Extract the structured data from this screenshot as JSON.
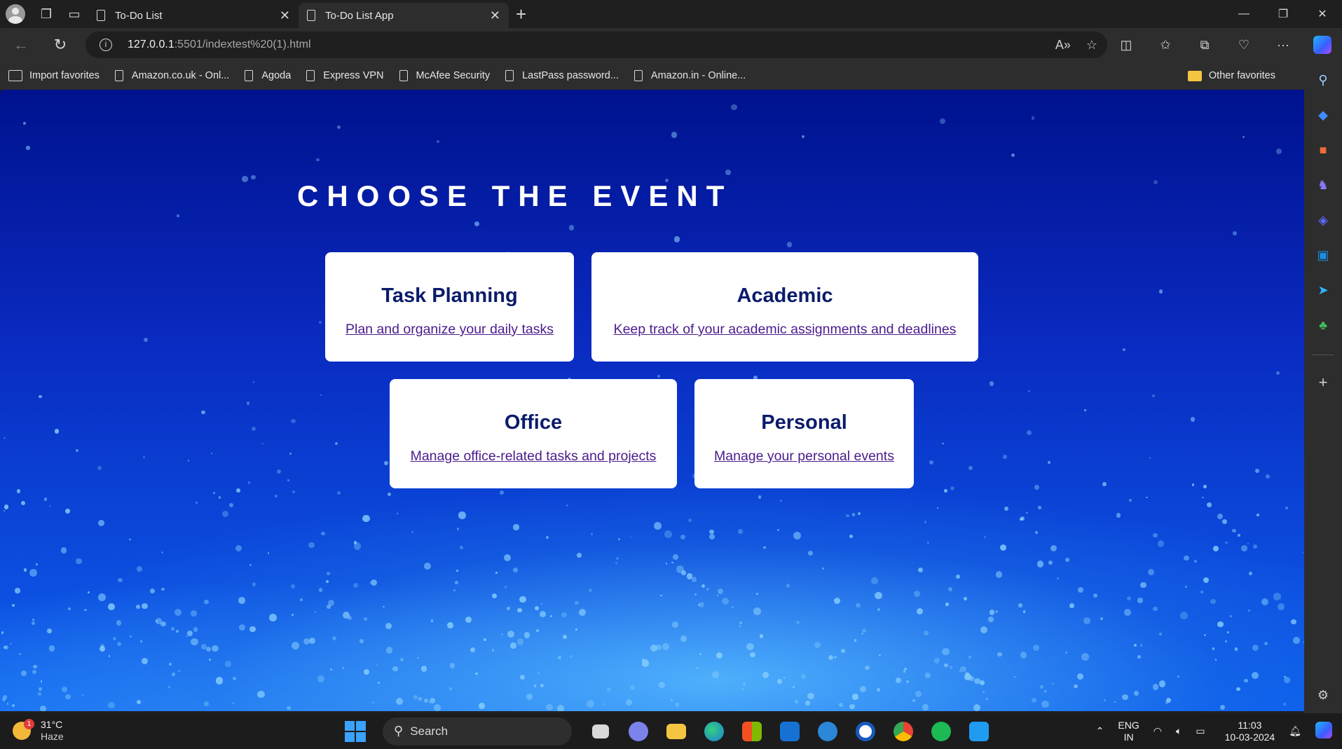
{
  "browser": {
    "tabs": [
      {
        "title": "To-Do List",
        "active": false
      },
      {
        "title": "To-Do List App",
        "active": true
      }
    ],
    "url_host": "127.0.0.1",
    "url_path": ":5501/indextest%20(1).html",
    "favorites": [
      {
        "label": "Import favorites",
        "icon": "import-icon"
      },
      {
        "label": "Amazon.co.uk - Onl...",
        "icon": "page-icon"
      },
      {
        "label": "Agoda",
        "icon": "page-icon"
      },
      {
        "label": "Express VPN",
        "icon": "page-icon"
      },
      {
        "label": "McAfee Security",
        "icon": "page-icon"
      },
      {
        "label": "LastPass password...",
        "icon": "page-icon"
      },
      {
        "label": "Amazon.in - Online...",
        "icon": "page-icon"
      }
    ],
    "other_favorites": "Other favorites"
  },
  "page": {
    "heading": "CHOOSE THE EVENT",
    "cards": [
      {
        "title": "Task Planning",
        "link": "Plan and organize your daily tasks"
      },
      {
        "title": "Academic",
        "link": "Keep track of your academic assignments and deadlines"
      },
      {
        "title": "Office",
        "link": "Manage office-related tasks and projects"
      },
      {
        "title": "Personal",
        "link": "Manage your personal events"
      }
    ]
  },
  "taskbar": {
    "weather_temp": "31°C",
    "weather_desc": "Haze",
    "weather_badge": "1",
    "search_label": "Search",
    "lang_line1": "ENG",
    "lang_line2": "IN",
    "time": "11:03",
    "date": "10-03-2024"
  },
  "colors": {
    "card_title": "#0b1b6b",
    "card_link": "#4b1b8c",
    "page_background": "#0a2ac0"
  }
}
